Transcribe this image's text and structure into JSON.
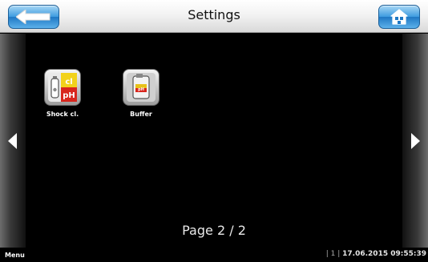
{
  "header": {
    "title": "Settings",
    "back_icon": "back-arrow-icon",
    "home_icon": "home-icon",
    "accent": "#3d9be0"
  },
  "tiles": [
    {
      "label": "Shock cl.",
      "icon": "shock-chlorine-icon",
      "badges": [
        "cl",
        "pH"
      ]
    },
    {
      "label": "Buffer",
      "icon": "buffer-canister-icon",
      "badges": [
        "pH"
      ]
    }
  ],
  "navigation": {
    "prev_icon": "triangle-left-icon",
    "next_icon": "triangle-right-icon"
  },
  "pager": {
    "text": "Page 2 / 2"
  },
  "footer": {
    "menu": "Menu",
    "separator1": "|",
    "counter": "1",
    "separator2": "|",
    "datetime": "17.06.2015 09:55:39"
  }
}
